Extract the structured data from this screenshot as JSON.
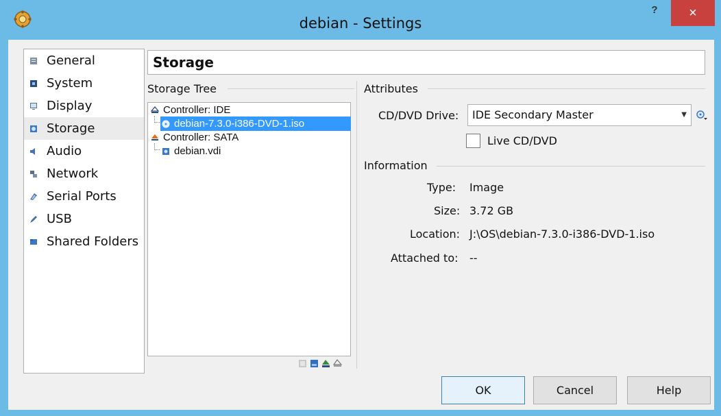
{
  "window": {
    "title": "debian - Settings",
    "help_glyph": "?",
    "close_glyph": "×"
  },
  "nav": {
    "items": [
      {
        "label": "General",
        "icon": "general-icon"
      },
      {
        "label": "System",
        "icon": "system-icon"
      },
      {
        "label": "Display",
        "icon": "display-icon"
      },
      {
        "label": "Storage",
        "icon": "storage-icon",
        "selected": true
      },
      {
        "label": "Audio",
        "icon": "audio-icon"
      },
      {
        "label": "Network",
        "icon": "network-icon"
      },
      {
        "label": "Serial Ports",
        "icon": "serial-ports-icon"
      },
      {
        "label": "USB",
        "icon": "usb-icon"
      },
      {
        "label": "Shared Folders",
        "icon": "shared-folders-icon"
      }
    ]
  },
  "section": {
    "title": "Storage"
  },
  "storage_tree": {
    "label": "Storage Tree",
    "rows": [
      {
        "label": "Controller: IDE",
        "kind": "controller"
      },
      {
        "label": "debian-7.3.0-i386-DVD-1.iso",
        "kind": "optical",
        "selected": true
      },
      {
        "label": "Controller: SATA",
        "kind": "controller"
      },
      {
        "label": "debian.vdi",
        "kind": "disk"
      }
    ]
  },
  "attributes": {
    "label": "Attributes",
    "drive_label": "CD/DVD Drive:",
    "drive_value": "IDE Secondary Master",
    "live_label": "Live CD/DVD",
    "live_checked": false
  },
  "information": {
    "label": "Information",
    "type_label": "Type:",
    "type_value": "Image",
    "size_label": "Size:",
    "size_value": "3.72 GB",
    "location_label": "Location:",
    "location_value": "J:\\OS\\debian-7.3.0-i386-DVD-1.iso",
    "attached_label": "Attached to:",
    "attached_value": "--"
  },
  "buttons": {
    "ok": "OK",
    "cancel": "Cancel",
    "help": "Help"
  },
  "colors": {
    "titlebar": "#6cbbe7",
    "close": "#c9413f",
    "selection": "#3399ff"
  }
}
